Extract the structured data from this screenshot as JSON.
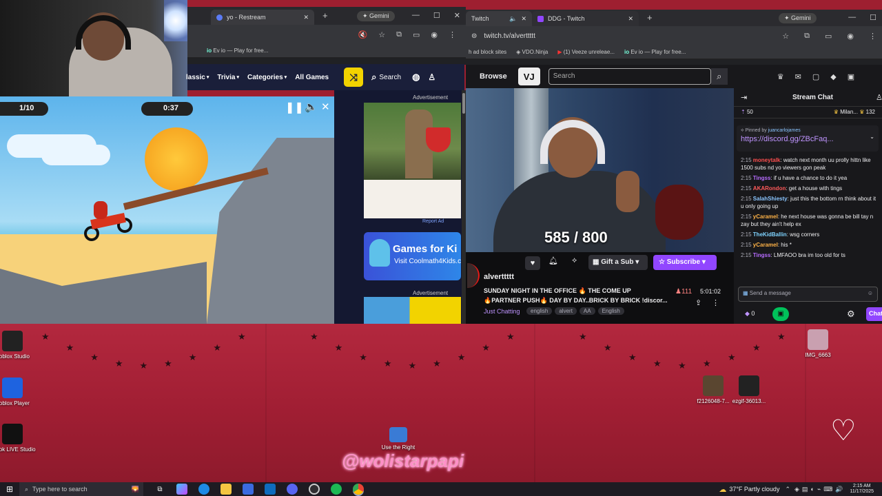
{
  "webcam": {
    "overlay": "@wolistarpapi"
  },
  "left_browser": {
    "tab_title": "yo - Restream",
    "gemini_label": "Gemini",
    "bookmark": "Ev io — Play for free...",
    "nav": [
      "lassic",
      "Trivia",
      "Categories",
      "All Games"
    ],
    "search_label": "Search",
    "ad_label_top": "Advertisement",
    "report_ad": "Report Ad",
    "banner_text": "Games for Ki",
    "banner_sub": "Visit Coolmath4Kids.c",
    "ad_label_bottom": "Advertisement",
    "hud_left": "1/10",
    "hud_right": "0:37"
  },
  "right_browser": {
    "tab1": "Twitch",
    "tab2": "DDG - Twitch",
    "gemini_label": "Gemini",
    "url": "twitch.tv/alverttttt",
    "bookmarks": [
      "h ad block sites",
      "VDO.Ninja",
      "(1) Veeze unreleae...",
      "Ev io — Play for free..."
    ],
    "browse": "Browse",
    "search_placeholder": "Search"
  },
  "stream": {
    "overlay": "585 / 800",
    "channel": "alverttttt",
    "title_line1": "SUNDAY NIGHT IN THE OFFICE 🔥 THE COME UP",
    "title_line2": "🔥PARTNER PUSH🔥 DAY BY DAY..BRICK BY BRICK !discor...",
    "category": "Just Chatting",
    "tags": [
      "english",
      "alvert",
      "AA",
      "English"
    ],
    "viewers": "111",
    "uptime": "5:01:02",
    "gift_label": "Gift a Sub",
    "subscribe_label": "Subscribe"
  },
  "chat": {
    "header": "Stream Chat",
    "count_left": "50",
    "top_user": "Milan...",
    "top_count": "132",
    "pinned_by": "Pinned by",
    "pinned_user": "juancarlojames",
    "pinned_link": "https://discord.gg/ZBcFaq...",
    "messages": [
      {
        "time": "2:15",
        "user": "moneytalk",
        "color": "#ff4f4f",
        "text": "watch next month uu prolly hittn like 1500 subs nd yo viewers gon peak"
      },
      {
        "time": "2:15",
        "user": "Tingss",
        "color": "#b76cff",
        "text": "if u have a chance to do it yea"
      },
      {
        "time": "2:15",
        "user": "AKARondon",
        "color": "#ff5a5a",
        "text": "get a house with tings"
      },
      {
        "time": "2:15",
        "user": "SalahShiesty",
        "color": "#8ac5ff",
        "text": "just this the bottom rn think about it u only going up"
      },
      {
        "time": "2:15",
        "user": "yCaramel",
        "color": "#ffb347",
        "text": "he next house was gonna be bill tay n zay but they ain't help ex"
      },
      {
        "time": "2:15",
        "user": "TheKidBallin",
        "color": "#7fd3ff",
        "text": "wsg corners"
      },
      {
        "time": "2:15",
        "user": "yCaramel",
        "color": "#ffb347",
        "text": "his *"
      },
      {
        "time": "2:15",
        "user": "Tingss",
        "color": "#b76cff",
        "text": "LMFAOO bra im too old for ts"
      }
    ],
    "send_placeholder": "Send a message",
    "points": "0",
    "chat_button": "Chat"
  },
  "desktop": {
    "icons": [
      {
        "label": "Roblox Studio",
        "color": "#222"
      },
      {
        "label": "Roblox Player",
        "color": "#1e63e0"
      },
      {
        "label": "TikTok LIVE Studio",
        "color": "#111"
      },
      {
        "label": "Use the Right",
        "color": "#3a7bd5"
      },
      {
        "label": "f2126048-7...",
        "color": "#5a4630"
      },
      {
        "label": "ezgif-36013...",
        "color": "#222"
      },
      {
        "label": "IMG_6663",
        "color": "#c9a0b0"
      }
    ]
  },
  "taskbar": {
    "search_placeholder": "Type here to search",
    "weather": "37°F  Partly cloudy",
    "time": "2:15 AM",
    "date": "11/17/2025"
  }
}
